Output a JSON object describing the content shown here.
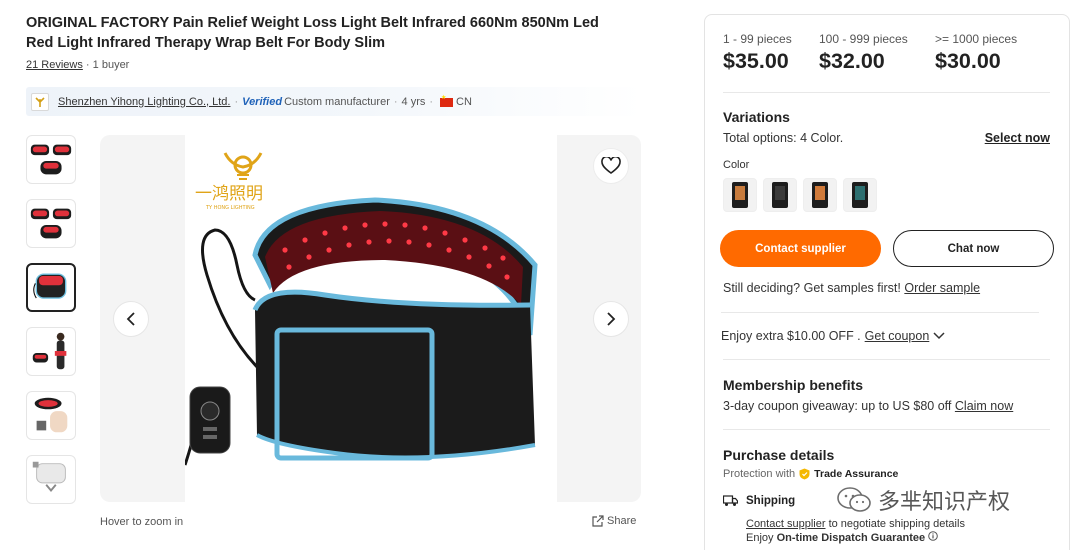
{
  "product": {
    "title": "ORIGINAL FACTORY Pain Relief Weight Loss Light Belt Infrared 660Nm 850Nm Led Red Light Infrared Therapy Wrap Belt For Body Slim",
    "reviews_link": "21 Reviews",
    "buyers": "1 buyer"
  },
  "supplier": {
    "name": "Shenzhen Yihong Lighting Co., Ltd.",
    "verified": "Verified",
    "type": "Custom manufacturer",
    "years": "4 yrs",
    "country": "CN"
  },
  "gallery": {
    "thumbnail_count": 6,
    "selected_index": 2,
    "hover_hint": "Hover to zoom in",
    "share_label": "Share",
    "logo_text": "TY HONG LIGHTING",
    "icons": {
      "favorite": "heart-icon",
      "prev": "chevron-left-icon",
      "next": "chevron-right-icon",
      "share": "share-icon"
    }
  },
  "pricing": [
    {
      "range": "1 - 99 pieces",
      "price": "$35.00"
    },
    {
      "range": "100 - 999 pieces",
      "price": "$32.00"
    },
    {
      "range": ">= 1000 pieces",
      "price": "$30.00"
    }
  ],
  "variations": {
    "title": "Variations",
    "total_options": "Total options: 4 Color.",
    "select_now": "Select now",
    "color_label": "Color",
    "swatch_colors": [
      "#c77b3d",
      "#3a3a3a",
      "#d07a3a",
      "#2d6f70"
    ]
  },
  "actions": {
    "contact_supplier": "Contact supplier",
    "chat_now": "Chat now",
    "samples_text": "Still deciding? Get samples first!",
    "order_sample": "Order sample",
    "accent_color": "#ff6a00"
  },
  "coupon": {
    "text": "Enjoy extra $10.00 OFF .",
    "link": "Get coupon"
  },
  "membership": {
    "title": "Membership benefits",
    "text": "3-day coupon giveaway: up to US $80 off",
    "link": "Claim now"
  },
  "purchase": {
    "title": "Purchase details",
    "protection": "Protection with",
    "trade_assurance": "Trade Assurance",
    "shipping_label": "Shipping",
    "contact_link": "Contact supplier",
    "contact_rest": "to negotiate shipping details",
    "enjoy": "Enjoy",
    "dispatch": "On-time Dispatch Guarantee"
  },
  "watermark": {
    "text": "多芈知识产权"
  }
}
